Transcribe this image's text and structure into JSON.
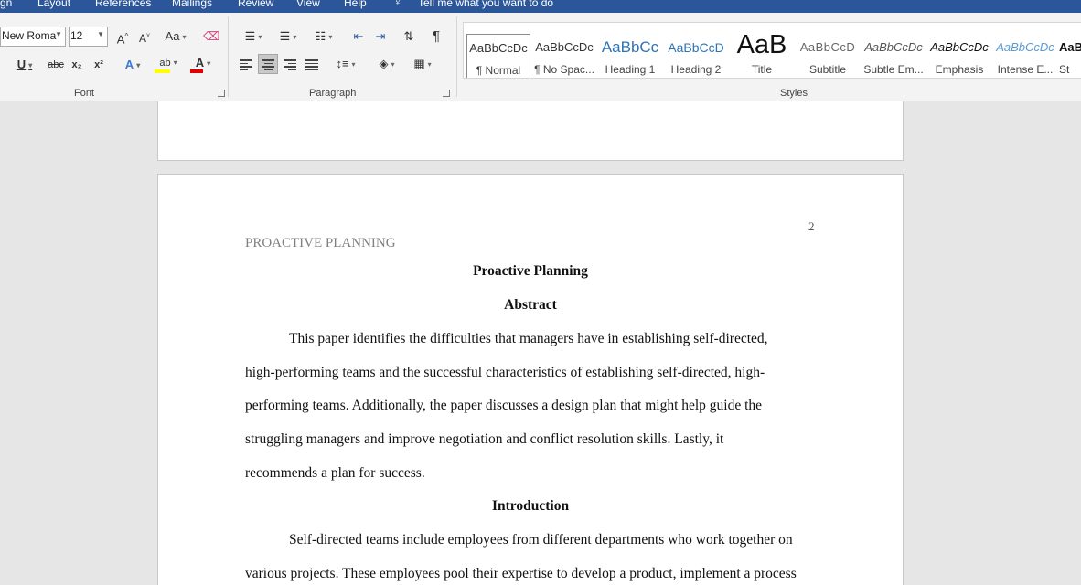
{
  "menu": {
    "items": [
      "gn",
      "Layout",
      "References",
      "Mailings",
      "Review",
      "View",
      "Help"
    ],
    "tell_me": "Tell me what you want to do"
  },
  "font_group": {
    "font_name": "New Roma",
    "font_size": "12",
    "grow_label": "A",
    "shrink_label": "A",
    "case_label": "Aa",
    "underline_label": "U",
    "strike_label": "abc",
    "subscript_label": "x₂",
    "superscript_label": "x²",
    "effects_label": "A",
    "highlight_label": "ab",
    "font_color_label": "A",
    "label": "Font",
    "highlight_color": "#ffff00",
    "font_color": "#e00000"
  },
  "paragraph_group": {
    "pilcrow_label": "¶",
    "label": "Paragraph"
  },
  "styles_group": {
    "label": "Styles",
    "items": [
      {
        "preview": "AaBbCcDc",
        "name": "¶ Normal"
      },
      {
        "preview": "AaBbCcDc",
        "name": "¶ No Spac..."
      },
      {
        "preview": "AaBbCc",
        "name": "Heading 1"
      },
      {
        "preview": "AaBbCcD",
        "name": "Heading 2"
      },
      {
        "preview": "AaB",
        "name": "Title"
      },
      {
        "preview": "AaBbCcD",
        "name": "Subtitle"
      },
      {
        "preview": "AaBbCcDc",
        "name": "Subtle Em..."
      },
      {
        "preview": "AaBbCcDc",
        "name": "Emphasis"
      },
      {
        "preview": "AaBbCcDc",
        "name": "Intense E..."
      },
      {
        "preview": "AaB",
        "name": "St"
      }
    ]
  },
  "document": {
    "page_number": "2",
    "running_head": "PROACTIVE PLANNING",
    "title": "Proactive Planning",
    "abstract_heading": "Abstract",
    "abstract_lines": [
      "This paper identifies the difficulties that managers have in establishing self-directed,",
      "high-performing teams and the successful characteristics of establishing self-directed, high-",
      "performing teams. Additionally, the paper discusses a design plan that might help guide the",
      "struggling managers and improve negotiation and conflict resolution skills. Lastly, it",
      "recommends a plan for success."
    ],
    "intro_heading": "Introduction",
    "intro_lines": [
      "Self-directed teams include employees from different departments who work together on",
      "various projects. These employees pool their expertise to develop a product, implement a process"
    ]
  }
}
